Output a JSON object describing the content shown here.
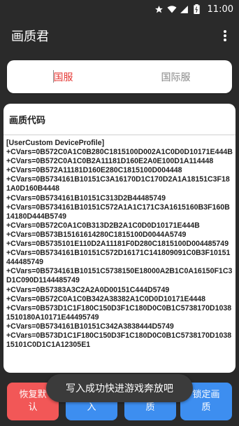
{
  "status_bar": {
    "time": "11:00",
    "icons": [
      "star-icon",
      "wifi-icon",
      "cellular-icon",
      "battery-icon"
    ]
  },
  "app": {
    "title": "画质君",
    "menu_icon": "more-vert-icon"
  },
  "tabs": [
    {
      "label": "国服",
      "active": true
    },
    {
      "label": "国际服",
      "active": false
    }
  ],
  "card": {
    "title": "画质代码",
    "code": "[UserCustom DeviceProfile]\n+CVars=0B572C0A1C0B280C1815100D002A1C0D0D10171E444B\n+CVars=0B572C0A1C0B2A11181D160E2A0E100D1A114448\n+CVars=0B572A11181D160E280C1815100D004448\n+CVars=0B5734161B10151C3A16170D1C170D2A1A18151C3F181A0D160B4448\n+CVars=0B5734161B10151C313D2B44485749\n+CVars=0B5734161B10151C572A1A1C171C3A1615160B3F160B14180D444B5749\n+CVars=0B572C0A1C0B313D2B2A1C0D0D10171E444B\n+CVars=0B573B15161614280C1815100D0044A5749\n+CVars=0B5735101E110D2A11181F0D280C1815100D004485749\n+CVars=0B5734161B10151C572D16171C141809091C0B3F10151444485749\n+CVars=0B5734161B10151C5738150E18000A2B1C0A16150F1C3D1C090D1144485749\n+CVars=0B57383A3C2A2A0D00151C444D5749\n+CVars=0B572C0A1C0B342A38382A1C0D0D10171E4448\n+CVars=0B573D1C1F180C150D3F1C180D0C0B1C5738170D10381510180A10171E44495749\n+CVars=0B5734161B10151C342A3838444D5749\n+CVars=0B573D1C1F180C150D3F1C180D0C0B1C5738170D103815101C0D1C1A12305E1"
  },
  "toast": "写入成功快进游戏奔放吧",
  "buttons": [
    {
      "label": "恢复默认",
      "color": "#f25757"
    },
    {
      "label": "保存写入",
      "color": "#3d8ef0"
    },
    {
      "label": "推荐画质",
      "color": "#3d8ef0"
    },
    {
      "label": "锁定画质",
      "color": "#3d8ef0"
    }
  ]
}
